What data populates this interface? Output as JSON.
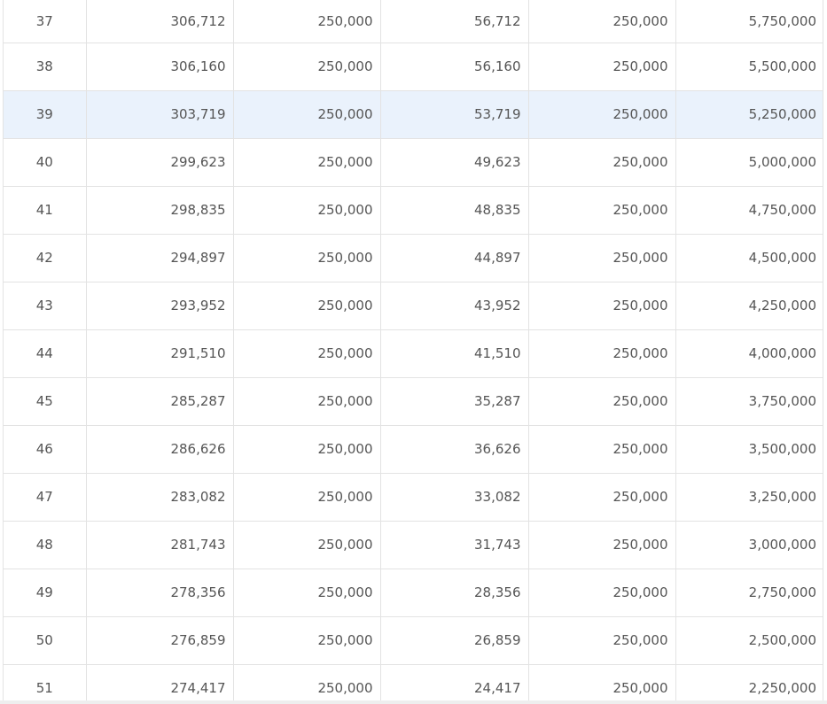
{
  "table": {
    "highlighted_row": "39",
    "rows": [
      [
        "37",
        "306,712",
        "250,000",
        "56,712",
        "250,000",
        "5,750,000"
      ],
      [
        "38",
        "306,160",
        "250,000",
        "56,160",
        "250,000",
        "5,500,000"
      ],
      [
        "39",
        "303,719",
        "250,000",
        "53,719",
        "250,000",
        "5,250,000"
      ],
      [
        "40",
        "299,623",
        "250,000",
        "49,623",
        "250,000",
        "5,000,000"
      ],
      [
        "41",
        "298,835",
        "250,000",
        "48,835",
        "250,000",
        "4,750,000"
      ],
      [
        "42",
        "294,897",
        "250,000",
        "44,897",
        "250,000",
        "4,500,000"
      ],
      [
        "43",
        "293,952",
        "250,000",
        "43,952",
        "250,000",
        "4,250,000"
      ],
      [
        "44",
        "291,510",
        "250,000",
        "41,510",
        "250,000",
        "4,000,000"
      ],
      [
        "45",
        "285,287",
        "250,000",
        "35,287",
        "250,000",
        "3,750,000"
      ],
      [
        "46",
        "286,626",
        "250,000",
        "36,626",
        "250,000",
        "3,500,000"
      ],
      [
        "47",
        "283,082",
        "250,000",
        "33,082",
        "250,000",
        "3,250,000"
      ],
      [
        "48",
        "281,743",
        "250,000",
        "31,743",
        "250,000",
        "3,000,000"
      ],
      [
        "49",
        "278,356",
        "250,000",
        "28,356",
        "250,000",
        "2,750,000"
      ],
      [
        "50",
        "276,859",
        "250,000",
        "26,859",
        "250,000",
        "2,500,000"
      ],
      [
        "51",
        "274,417",
        "250,000",
        "24,417",
        "250,000",
        "2,250,000"
      ]
    ]
  },
  "colors": {
    "highlight_background": "#eaf2fc",
    "grid_line": "#e3e3e3",
    "text": "#555555"
  }
}
